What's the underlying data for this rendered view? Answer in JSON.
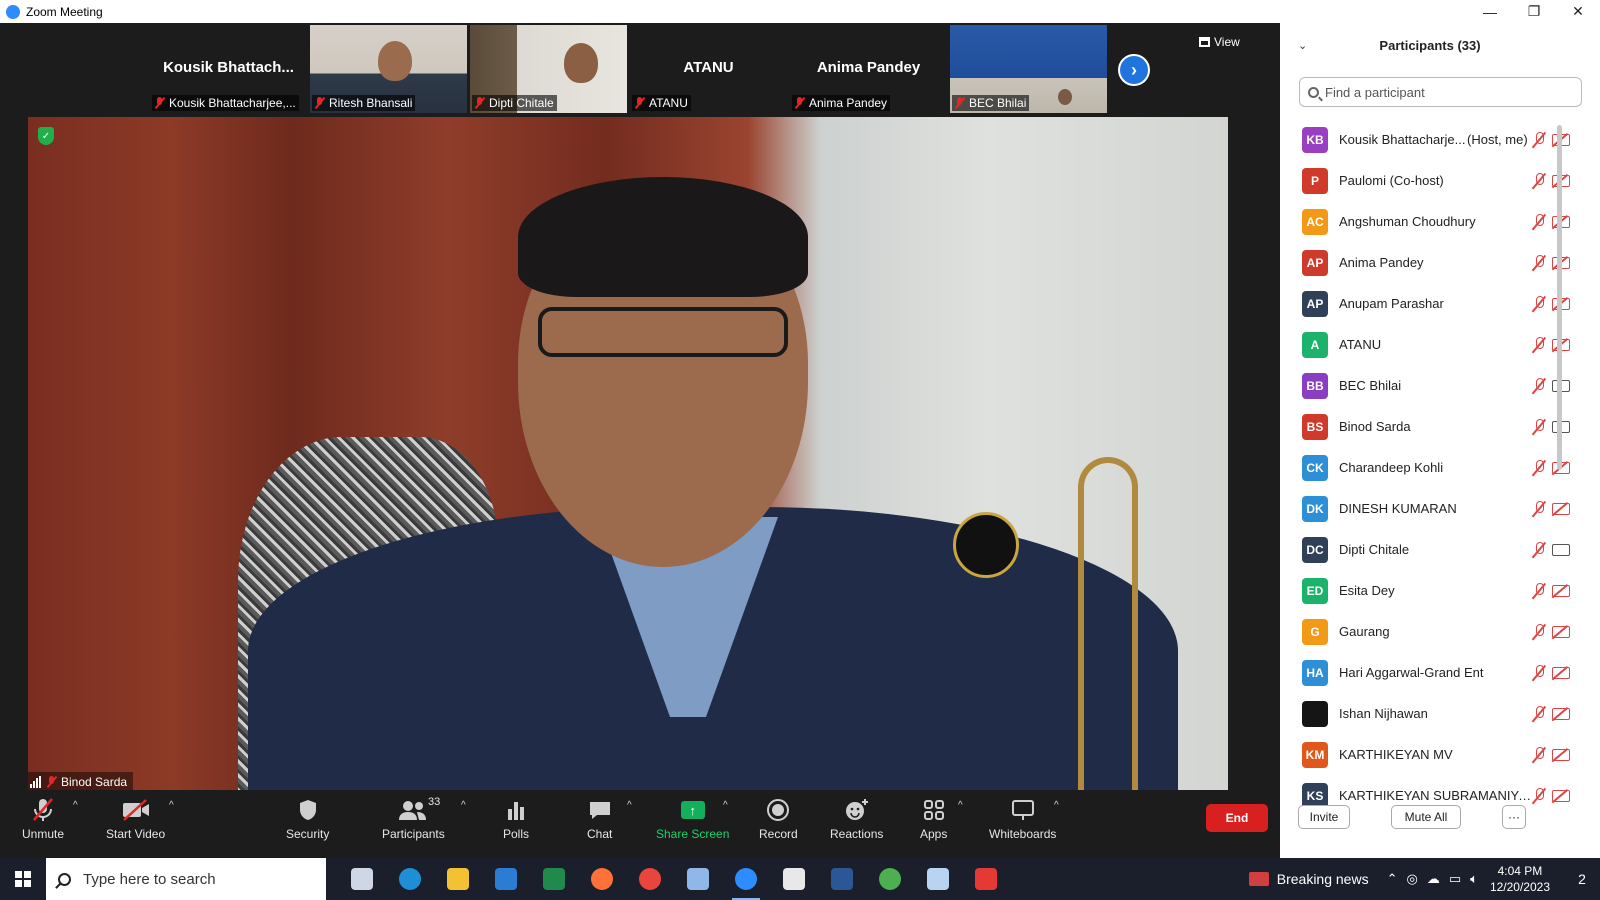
{
  "window": {
    "title": "Zoom Meeting",
    "controls": [
      "—",
      "❐",
      "✕"
    ]
  },
  "strip": {
    "tiles": [
      {
        "type": "name",
        "display_name": "Kousik  Bhattach...",
        "label": "Kousik Bhattacharjee,..."
      },
      {
        "type": "photo",
        "style": "photo-a",
        "label": "Ritesh Bhansali"
      },
      {
        "type": "photo",
        "style": "photo-b",
        "label": "Dipti Chitale"
      },
      {
        "type": "name",
        "display_name": "ATANU",
        "label": "ATANU"
      },
      {
        "type": "name",
        "display_name": "Anima Pandey",
        "label": "Anima Pandey"
      },
      {
        "type": "photo",
        "style": "photo-c",
        "label": "BEC Bhilai"
      }
    ],
    "next_icon": "›",
    "view_label": "View"
  },
  "main_video": {
    "speaker": "Binod Sarda",
    "shield_icon": "✓"
  },
  "toolbar": {
    "unmute": "Unmute",
    "start_video": "Start Video",
    "security": "Security",
    "participants": "Participants",
    "participants_count": "33",
    "polls": "Polls",
    "chat": "Chat",
    "share_screen": "Share Screen",
    "record": "Record",
    "reactions": "Reactions",
    "apps": "Apps",
    "whiteboards": "Whiteboards",
    "end": "End",
    "caret": "^"
  },
  "panel": {
    "title": "Participants (33)",
    "collapse_icon": "⌄",
    "search_placeholder": "Find a participant",
    "invite": "Invite",
    "mute_all": "Mute All",
    "more": "···",
    "participants": [
      {
        "initials": "KB",
        "color": "#9b3fc2",
        "name": "Kousik Bhattacharje...",
        "role": "(Host, me)",
        "video": "off"
      },
      {
        "initials": "P",
        "color": "#d03a2a",
        "name": "Paulomi (Co-host)",
        "role": "",
        "video": "off"
      },
      {
        "initials": "AC",
        "color": "#f29a17",
        "name": "Angshuman Choudhury",
        "role": "",
        "video": "off"
      },
      {
        "initials": "AP",
        "color": "#d03a2a",
        "name": "Anima Pandey",
        "role": "",
        "video": "off"
      },
      {
        "initials": "AP",
        "color": "#2f4058",
        "name": "Anupam Parashar",
        "role": "",
        "video": "off"
      },
      {
        "initials": "A",
        "color": "#1bb36b",
        "name": "ATANU",
        "role": "",
        "video": "off"
      },
      {
        "initials": "BB",
        "color": "#8a3fc2",
        "name": "BEC Bhilai",
        "role": "",
        "video": "on"
      },
      {
        "initials": "BS",
        "color": "#d03a2a",
        "name": "Binod Sarda",
        "role": "",
        "video": "on"
      },
      {
        "initials": "CK",
        "color": "#2d8fd6",
        "name": "Charandeep Kohli",
        "role": "",
        "video": "off"
      },
      {
        "initials": "DK",
        "color": "#2d8fd6",
        "name": "DINESH KUMARAN",
        "role": "",
        "video": "off"
      },
      {
        "initials": "DC",
        "color": "#2f4058",
        "name": "Dipti Chitale",
        "role": "",
        "video": "on"
      },
      {
        "initials": "ED",
        "color": "#1bb36b",
        "name": "Esita Dey",
        "role": "",
        "video": "off"
      },
      {
        "initials": "G",
        "color": "#f29a17",
        "name": "Gaurang",
        "role": "",
        "video": "off"
      },
      {
        "initials": "HA",
        "color": "#2d8fd6",
        "name": "Hari Aggarwal-Grand Ent",
        "role": "",
        "video": "off"
      },
      {
        "initials": "",
        "color": "#151515",
        "name": "Ishan Nijhawan",
        "role": "",
        "video": "off"
      },
      {
        "initials": "KM",
        "color": "#e0561b",
        "name": "KARTHIKEYAN MV",
        "role": "",
        "video": "off"
      },
      {
        "initials": "KS",
        "color": "#2f4058",
        "name": "KARTHIKEYAN SUBRAMANIYAM",
        "role": "",
        "video": "off"
      }
    ]
  },
  "taskbar": {
    "search_text": "Type here to search",
    "news": "Breaking news",
    "time": "4:04 PM",
    "date": "12/20/2023",
    "notif_count": "2",
    "apps": [
      {
        "name": "task-view-icon",
        "color": "#cfd6e6"
      },
      {
        "name": "edge-icon",
        "color": "#1e8fd6"
      },
      {
        "name": "file-explorer-icon",
        "color": "#f2c232"
      },
      {
        "name": "mail-icon",
        "color": "#2b7cd3"
      },
      {
        "name": "excel-icon",
        "color": "#1f8a4c"
      },
      {
        "name": "firefox-icon",
        "color": "#ff7139"
      },
      {
        "name": "chrome-icon",
        "color": "#e8453c"
      },
      {
        "name": "paint-icon",
        "color": "#8fb8e8"
      },
      {
        "name": "zoom-icon",
        "color": "#2d8cff"
      },
      {
        "name": "store-icon",
        "color": "#e8e8e8"
      },
      {
        "name": "word-icon",
        "color": "#2b5797"
      },
      {
        "name": "chrome-profile-icon",
        "color": "#4caf50"
      },
      {
        "name": "mail-app-icon",
        "color": "#b8d4f0"
      },
      {
        "name": "anydesk-icon",
        "color": "#e53935"
      }
    ]
  }
}
